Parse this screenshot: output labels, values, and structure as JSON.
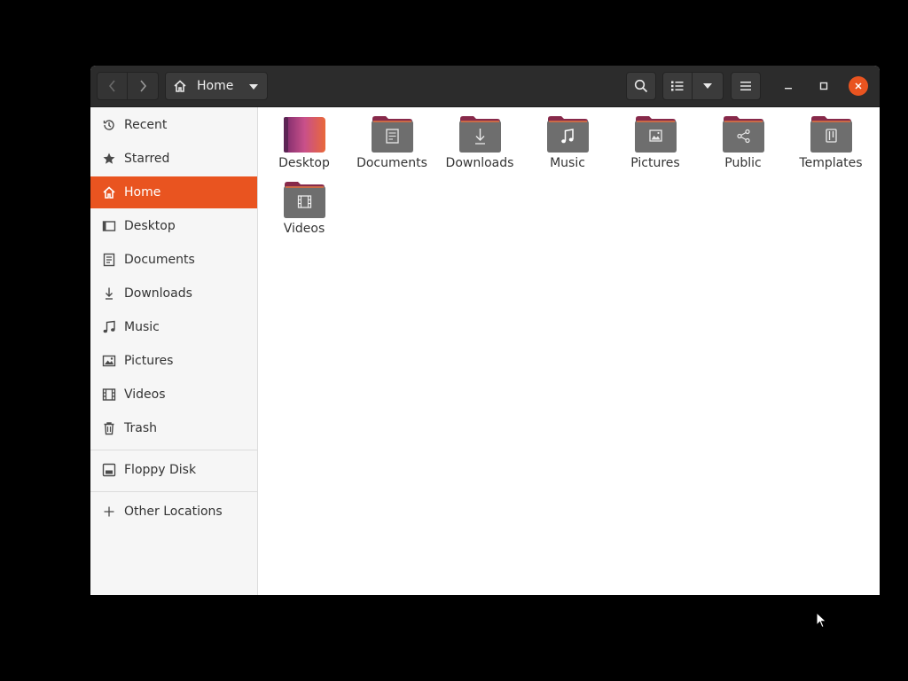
{
  "headerbar": {
    "path_label": "Home",
    "icons": {
      "back": "chevron-left-icon",
      "forward": "chevron-right-icon",
      "home": "home-icon",
      "search": "search-icon",
      "list_view": "list-view-icon",
      "view_options": "chevron-down-icon",
      "menu": "hamburger-menu-icon",
      "minimize": "minimize-icon",
      "maximize": "maximize-icon",
      "close": "close-icon"
    }
  },
  "sidebar": {
    "items": [
      {
        "label": "Recent",
        "icon": "clock-icon"
      },
      {
        "label": "Starred",
        "icon": "star-icon"
      },
      {
        "label": "Home",
        "icon": "home-icon",
        "active": true
      },
      {
        "label": "Desktop",
        "icon": "desktop-icon"
      },
      {
        "label": "Documents",
        "icon": "document-icon"
      },
      {
        "label": "Downloads",
        "icon": "download-icon"
      },
      {
        "label": "Music",
        "icon": "music-icon"
      },
      {
        "label": "Pictures",
        "icon": "picture-icon"
      },
      {
        "label": "Videos",
        "icon": "film-icon"
      },
      {
        "label": "Trash",
        "icon": "trash-icon"
      },
      {
        "label": "Floppy Disk",
        "icon": "floppy-icon"
      },
      {
        "label": "Other Locations",
        "icon": "plus-icon"
      }
    ]
  },
  "content": {
    "folders": [
      {
        "label": "Desktop",
        "icon": "desktop-folder-icon"
      },
      {
        "label": "Documents",
        "icon": "documents-folder-icon"
      },
      {
        "label": "Downloads",
        "icon": "downloads-folder-icon"
      },
      {
        "label": "Music",
        "icon": "music-folder-icon"
      },
      {
        "label": "Pictures",
        "icon": "pictures-folder-icon"
      },
      {
        "label": "Public",
        "icon": "public-folder-icon"
      },
      {
        "label": "Templates",
        "icon": "templates-folder-icon"
      },
      {
        "label": "Videos",
        "icon": "videos-folder-icon"
      }
    ]
  },
  "colors": {
    "accent": "#e95420",
    "headerbar": "#2c2c2c",
    "sidebar": "#f6f6f6",
    "folder_body": "#6d6d6d",
    "folder_tab": "#87294a"
  }
}
